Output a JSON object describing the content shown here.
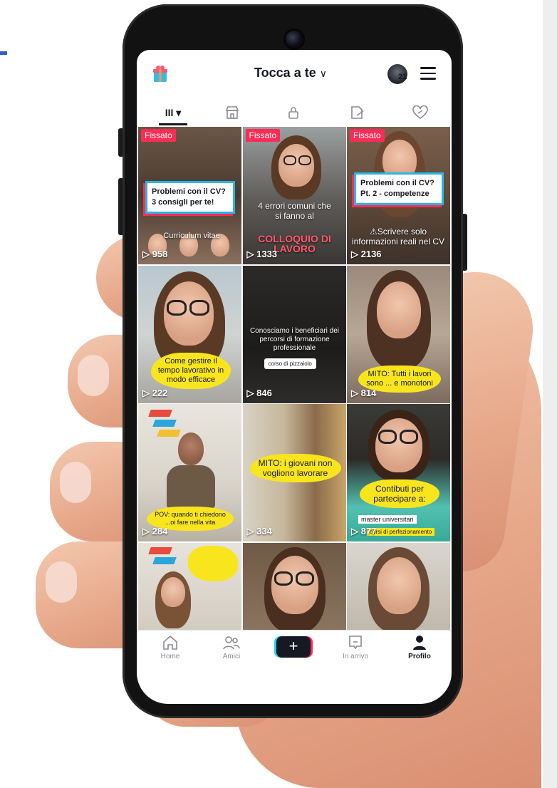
{
  "header": {
    "title": "Tocca a te",
    "title_chevron": "∨",
    "notification_count": "21"
  },
  "tabs": [
    {
      "icon": "grid-icon",
      "label": "III ▾",
      "active": true
    },
    {
      "icon": "shop-icon",
      "active": false
    },
    {
      "icon": "lock-icon",
      "active": false
    },
    {
      "icon": "repost-icon",
      "active": false
    },
    {
      "icon": "liked-heart-icon",
      "active": false
    }
  ],
  "videos": [
    {
      "pinned": "Fissato",
      "views": "958",
      "caption": "Problemi con il CV? 3 consigli per te!",
      "overlay": "Curriculum vitae"
    },
    {
      "pinned": "Fissato",
      "views": "1333",
      "overlay": "4 errori comuni che si fanno al",
      "overlay2": "COLLOQUIO DI LAVORO"
    },
    {
      "pinned": "Fissato",
      "views": "2136",
      "caption": "Problemi con il CV? Pt. 2 - competenze",
      "overlay": "⚠Scrivere solo informazioni reali nel CV"
    },
    {
      "views": "222",
      "blob": "Come gestire il tempo lavorativo in modo efficace"
    },
    {
      "views": "846",
      "overlay": "Conosciamo i beneficiari dei percorsi di formazione professionale",
      "chip": "corso di pizzaiolo"
    },
    {
      "views": "814",
      "blob": "MITO: Tutti i lavori sono ... e monotoni"
    },
    {
      "views": "284",
      "blob": "POV: quando ti chiedono ...oi fare nella vita"
    },
    {
      "views": "334",
      "blob": "MITO: i giovani non vogliono lavorare"
    },
    {
      "views": "877",
      "caption": "Contibuti per partecipare a:",
      "overlay": "master universitari",
      "overlay2": "corsi di perfezionamento"
    },
    {
      "views": ""
    },
    {
      "views": ""
    },
    {
      "views": ""
    }
  ],
  "bottom_nav": [
    {
      "icon": "home-icon",
      "label": "Home",
      "active": false
    },
    {
      "icon": "friends-icon",
      "label": "Amici",
      "active": false
    },
    {
      "icon": "plus-icon",
      "label": "+",
      "active": false
    },
    {
      "icon": "inbox-icon",
      "label": "In arrivo",
      "active": false
    },
    {
      "icon": "profile-icon",
      "label": "Profilo",
      "active": true
    }
  ],
  "colors": {
    "accent_red": "#fe2c55",
    "accent_cyan": "#27d3e6",
    "caption_blob": "#f9e51e",
    "text_dark": "#161823"
  }
}
